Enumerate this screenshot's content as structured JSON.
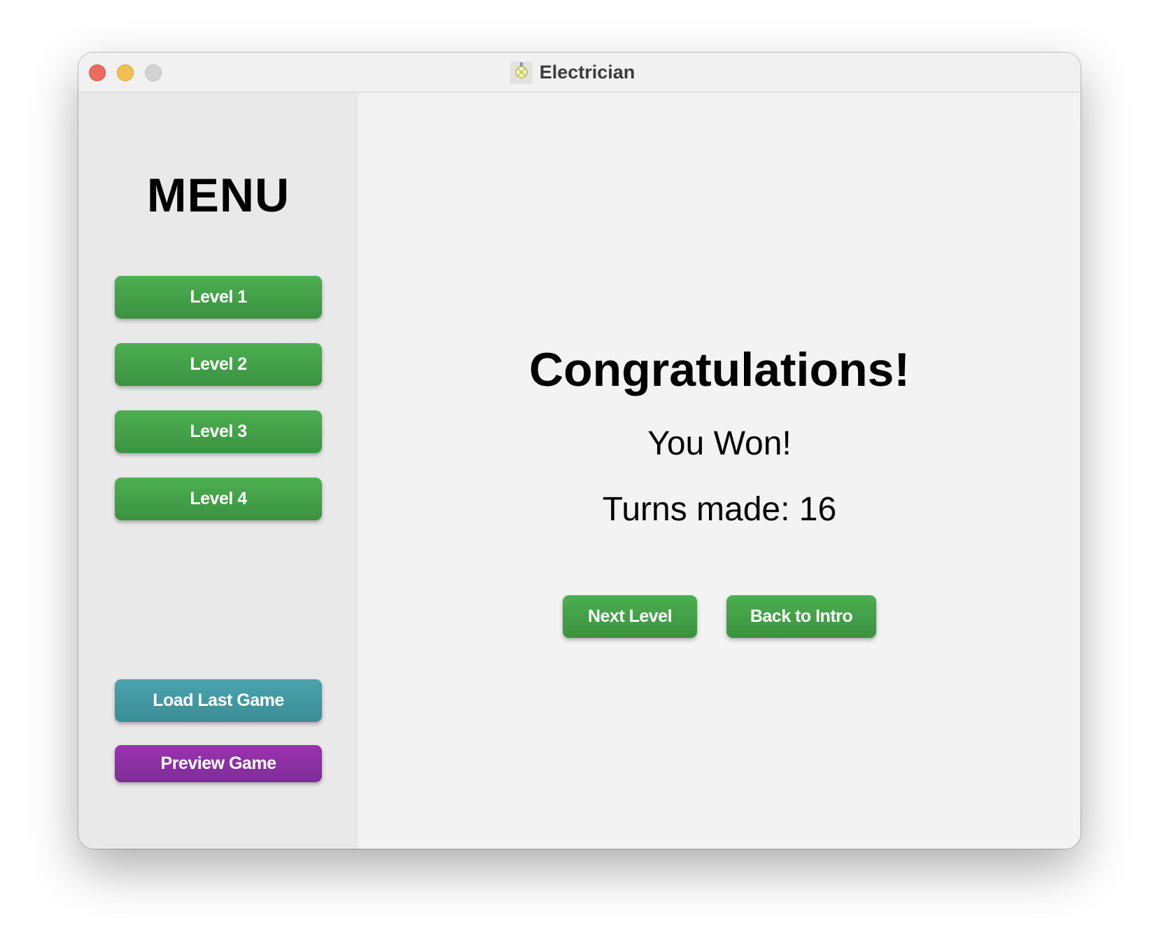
{
  "window": {
    "title": "Electrician",
    "icon": "lightbulb-icon"
  },
  "sidebar": {
    "heading": "MENU",
    "levels": [
      {
        "label": "Level 1"
      },
      {
        "label": "Level 2"
      },
      {
        "label": "Level 3"
      },
      {
        "label": "Level 4"
      }
    ],
    "load_label": "Load Last Game",
    "preview_label": "Preview Game"
  },
  "main": {
    "heading": "Congratulations!",
    "message": "You Won!",
    "turns_label": "Turns made:",
    "turns_value": "16",
    "next_label": "Next Level",
    "back_label": "Back to Intro"
  },
  "colors": {
    "green_button": "#4caf50",
    "teal_button": "#4aa3ad",
    "purple_button": "#9b32b0",
    "close": "#ec6a5e",
    "minimize": "#f4bf4f",
    "zoom": "#d3d3d3"
  }
}
